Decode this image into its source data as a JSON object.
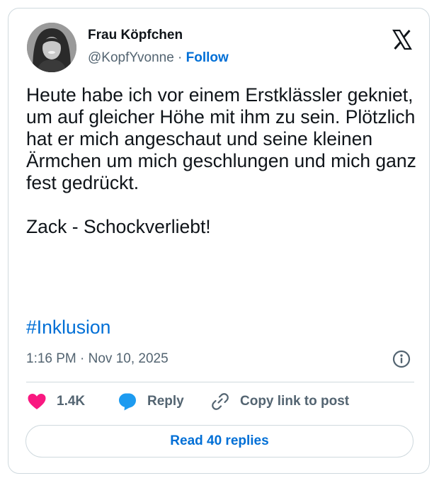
{
  "author": {
    "name": "Frau Köpfchen",
    "handle": "@KopfYvonne",
    "separator": "·",
    "follow_label": "Follow"
  },
  "tweet": {
    "text": "Heute habe ich vor einem Erstklässler gekniet, um auf gleicher Höhe mit ihm zu sein. Plötzlich hat er mich angeschaut und seine kleinen Ärmchen um mich geschlungen und mich ganz fest gedrückt.\n\nZack - Schockverliebt!",
    "hashtag": "#Inklusion",
    "timestamp": "1:16 PM · Nov 10, 2025"
  },
  "actions": {
    "like_count": "1.4K",
    "reply_label": "Reply",
    "copy_label": "Copy link to post"
  },
  "footer": {
    "read_replies_label": "Read 40 replies"
  },
  "icons": {
    "brand": "x-logo-icon",
    "like": "heart-icon",
    "reply": "speech-bubble-icon",
    "copy": "link-icon",
    "info": "info-icon"
  },
  "colors": {
    "like": "#f91880",
    "reply": "#1d9bf0",
    "link": "#006fd6",
    "text": "#0f1419",
    "muted": "#536471",
    "border": "#cfd9de"
  }
}
